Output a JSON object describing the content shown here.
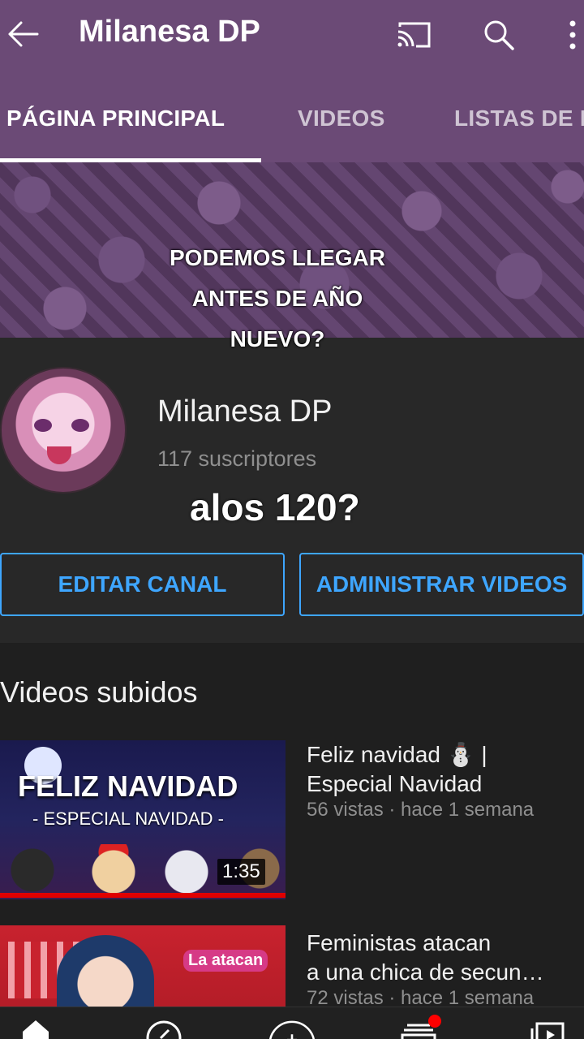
{
  "appbar": {
    "title": "Milanesa DP",
    "back_icon": "arrow-left-icon",
    "cast_icon": "cast-icon",
    "search_icon": "search-icon",
    "more_icon": "more-vertical-icon"
  },
  "tabs": [
    {
      "label": "PÁGINA PRINCIPAL",
      "active": true
    },
    {
      "label": "VIDEOS",
      "active": false
    },
    {
      "label": "LISTAS DE R",
      "active": false
    }
  ],
  "overlay_caption": [
    "PODEMOS LLEGAR",
    "ANTES DE AÑO",
    "NUEVO?"
  ],
  "channel": {
    "name": "Milanesa DP",
    "subscribers": "117 suscriptores",
    "caption": "alos 120?"
  },
  "buttons": {
    "edit": "EDITAR CANAL",
    "manage": "ADMINISTRAR VIDEOS"
  },
  "section": {
    "title": "Videos subidos"
  },
  "videos": [
    {
      "title_line1": "Feliz navidad ⛄ |",
      "title_line2": "Especial Navidad",
      "meta": "56 vistas · hace 1 semana",
      "duration": "1:35",
      "thumb_text1": "FELIZ NAVIDAD",
      "thumb_text2": "- ESPECIAL NAVIDAD -"
    },
    {
      "title_line1": "Feministas atacan",
      "title_line2": "a una chica de secun…",
      "meta": "72 vistas · hace 1 semana",
      "thumb_tag": "La atacan"
    }
  ],
  "bottom_nav": [
    "home-icon",
    "explore-icon",
    "add-icon",
    "subscriptions-icon",
    "library-icon"
  ],
  "colors": {
    "appbar": "#6b4a76",
    "accent_blue": "#3ea6ff",
    "background": "#1f1f1f",
    "badge": "#ff0000"
  }
}
